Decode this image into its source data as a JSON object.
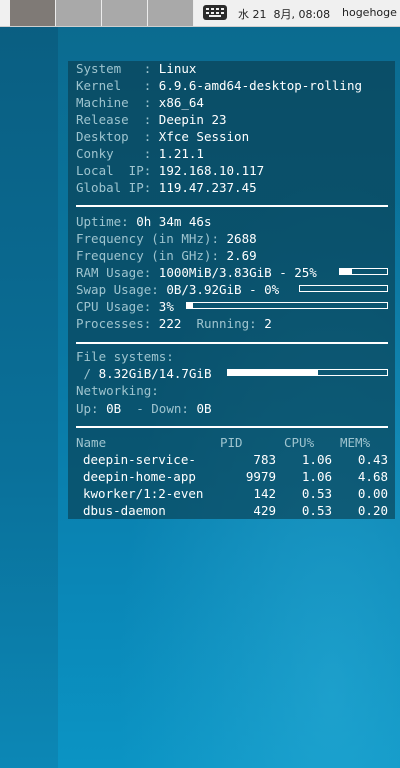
{
  "panel": {
    "workspaces": [
      {
        "name": "workspace-1",
        "active": true
      },
      {
        "name": "workspace-2",
        "active": false
      },
      {
        "name": "workspace-3",
        "active": false
      },
      {
        "name": "workspace-4",
        "active": false
      }
    ],
    "keyboard_icon": "keyboard-icon",
    "clock": "水 21  8月, 08:08",
    "user": "hogehoge"
  },
  "conky": {
    "system": {
      "system_label": "System   :",
      "system": "Linux",
      "kernel_label": "Kernel   :",
      "kernel": "6.9.6-amd64-desktop-rolling",
      "machine_label": "Machine  :",
      "machine": "x86_64",
      "release_label": "Release  :",
      "release": "Deepin 23",
      "desktop_label": "Desktop  :",
      "desktop": "Xfce Session",
      "conky_label": "Conky    :",
      "conky": "1.21.1",
      "local_ip_label": "Local  IP:",
      "local_ip": "192.168.10.117",
      "global_ip_label": "Global IP:",
      "global_ip": "119.47.237.45"
    },
    "stats": {
      "uptime_label": "Uptime:",
      "uptime": "0h 34m 46s",
      "freq_mhz_label": "Frequency (in MHz):",
      "freq_mhz": "2688",
      "freq_ghz_label": "Frequency (in GHz):",
      "freq_ghz": "2.69",
      "ram_label": "RAM Usage:",
      "ram": "1000MiB/3.83GiB - 25%",
      "ram_fraction": 0.25,
      "swap_label": "Swap Usage:",
      "swap": "0B/3.92GiB - 0%",
      "swap_fraction": 0.0,
      "cpu_label": "CPU Usage:",
      "cpu": "3%",
      "cpu_fraction": 0.03,
      "processes_label": "Processes:",
      "processes": "222",
      "running_label": "Running:",
      "running": "2"
    },
    "fs": {
      "title": "File systems:",
      "root_label": " /",
      "root": "8.32GiB/14.7GiB",
      "root_fraction": 0.566,
      "net_title": "Networking:",
      "up_label": "Up:",
      "up": "0B",
      "down_label": "- Down:",
      "down": "0B"
    },
    "top": {
      "headers": {
        "name": "Name",
        "pid": "PID",
        "cpu": "CPU%",
        "mem": "MEM%"
      },
      "rows": [
        {
          "name": "deepin-service-",
          "pid": "783",
          "cpu": "1.06",
          "mem": "0.43"
        },
        {
          "name": "deepin-home-app",
          "pid": "9979",
          "cpu": "1.06",
          "mem": "4.68"
        },
        {
          "name": "kworker/1:2-even",
          "pid": "142",
          "cpu": "0.53",
          "mem": "0.00"
        },
        {
          "name": "dbus-daemon",
          "pid": "429",
          "cpu": "0.53",
          "mem": "0.20"
        }
      ]
    }
  }
}
